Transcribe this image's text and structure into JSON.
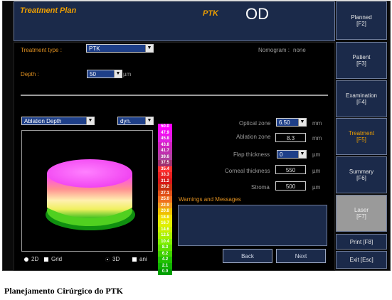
{
  "header": {
    "title": "Treatment Plan",
    "procedure": "PTK",
    "eye": "OD"
  },
  "form": {
    "treatment_type_label": "Treatment type :",
    "treatment_type_value": "PTK",
    "nomogram_label": "Nomogram :",
    "nomogram_value": "none",
    "depth_label": "Depth :",
    "depth_value": "50",
    "depth_unit": "µm"
  },
  "map": {
    "view_select": "Ablation Depth",
    "scale_select": "dyn.",
    "scale_values": [
      "50.0",
      "47.9",
      "45.8",
      "43.8",
      "41.7",
      "39.6",
      "37.5",
      "35.4",
      "33.3",
      "31.2",
      "29.2",
      "27.1",
      "25.0",
      "22.9",
      "20.8",
      "18.8",
      "16.7",
      "14.6",
      "12.5",
      "10.4",
      "8.3",
      "6.2",
      "4.2",
      "2.1",
      "0.0"
    ],
    "scale_colors": [
      "#ff00ff",
      "#f010f0",
      "#e020e0",
      "#d020c0",
      "#c030b0",
      "#b040a0",
      "#a03070",
      "#ff3030",
      "#e82020",
      "#d81818",
      "#c83010",
      "#e05018",
      "#f07020",
      "#f09a20",
      "#f0c000",
      "#f0e000",
      "#e0f000",
      "#c8f000",
      "#a8f000",
      "#80f000",
      "#60e000",
      "#40d000",
      "#20c000",
      "#10b000",
      "#00a000"
    ],
    "options": {
      "twod_label": "2D",
      "grid_label": "Grid",
      "threed_label": "3D",
      "ani_label": "ani"
    }
  },
  "parameters": {
    "optical_zone_label": "Optical zone",
    "optical_zone_value": "6.50",
    "optical_zone_unit": "mm",
    "ablation_zone_label": "Ablation zone",
    "ablation_zone_value": "8.3",
    "ablation_zone_unit": "mm",
    "flap_thickness_label": "Flap thickness",
    "flap_thickness_value": "0",
    "flap_thickness_unit": "µm",
    "corneal_thickness_label": "Corneal thickness",
    "corneal_thickness_value": "550",
    "corneal_thickness_unit": "µm",
    "stroma_label": "Stroma",
    "stroma_value": "500",
    "stroma_unit": "µm"
  },
  "warnings": {
    "title": "Warnings and Messages"
  },
  "nav_buttons": {
    "back": "Back",
    "next": "Next"
  },
  "sidebar": {
    "planned": [
      "Planned",
      "[F2]"
    ],
    "patient": [
      "Patient",
      "[F3]"
    ],
    "examination": [
      "Examination",
      "[F4]"
    ],
    "treatment": [
      "Treatment",
      "[F5]"
    ],
    "summary": [
      "Summary",
      "[F6]"
    ],
    "laser": [
      "Laser",
      "[F7]"
    ],
    "print": "Print [F8]",
    "exit": "Exit [Esc]"
  },
  "caption": "Planejamento Cirúrgico do PTK"
}
